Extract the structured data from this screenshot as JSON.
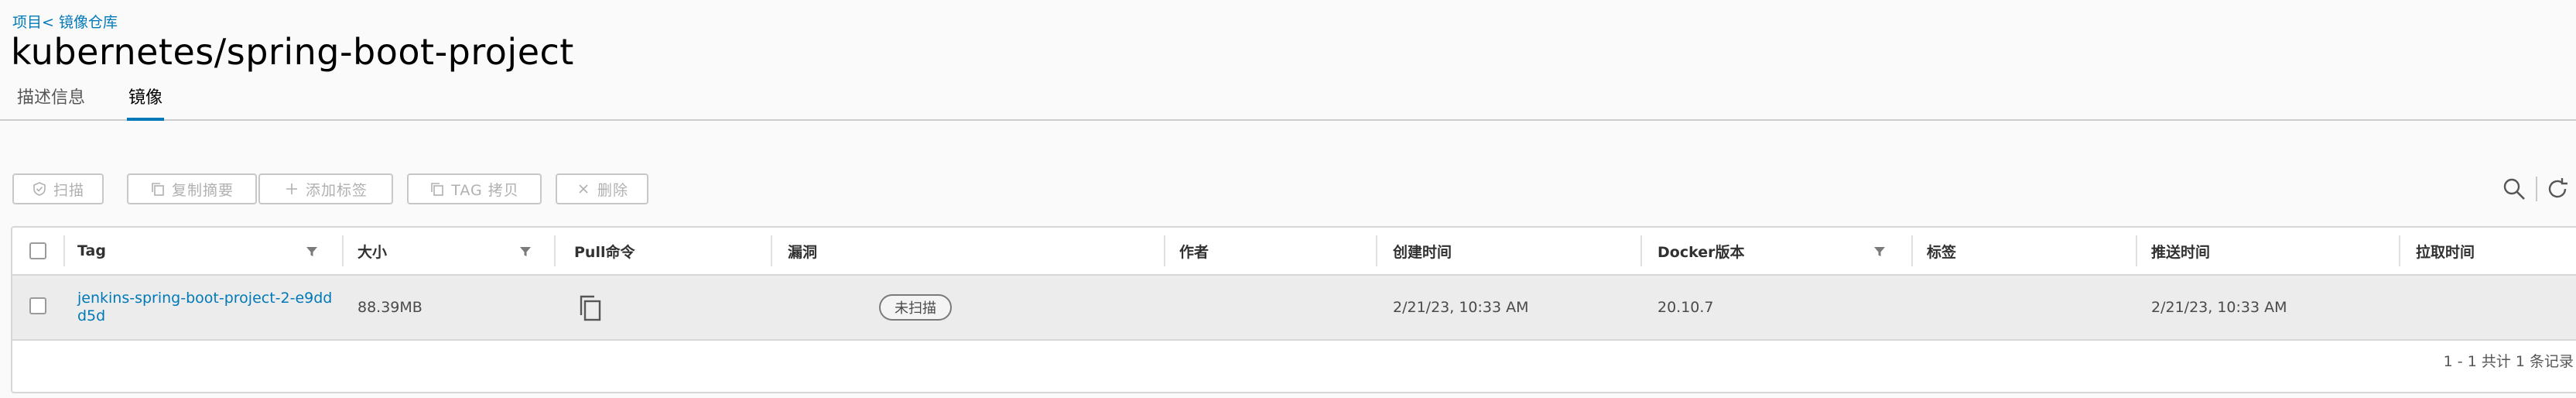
{
  "breadcrumb": "项目< 镜像仓库",
  "title": "kubernetes/spring-boot-project",
  "tabs": [
    {
      "label": "描述信息",
      "active": false
    },
    {
      "label": "镜像",
      "active": true
    }
  ],
  "toolbar": {
    "scan": "扫描",
    "copy_digest": "复制摘要",
    "add_label": "添加标签",
    "tag_copy": "TAG 拷贝",
    "delete": "删除"
  },
  "columns": {
    "tag": "Tag",
    "size": "大小",
    "pull": "Pull命令",
    "vuln": "漏洞",
    "author": "作者",
    "created": "创建时间",
    "docker": "Docker版本",
    "labels": "标签",
    "pushed": "推送时间",
    "pulled": "拉取时间"
  },
  "rows": [
    {
      "tag": "jenkins-spring-boot-project-2-e9ddd5d",
      "size": "88.39MB",
      "vuln": "未扫描",
      "author": "",
      "created": "2/21/23, 10:33 AM",
      "docker": "20.10.7",
      "labels": "",
      "pushed": "2/21/23, 10:33 AM",
      "pulled": ""
    }
  ],
  "footer": "1 - 1 共计 1 条记录",
  "colors": {
    "accent": "#0079b8",
    "disabled": "#b0b0b0",
    "row_bg": "#ececec"
  },
  "icons": {
    "scan": "shield-check-icon",
    "copy_digest": "copy-icon",
    "add_label": "plus-icon",
    "tag_copy": "copy-icon",
    "delete": "close-icon",
    "search": "search-icon",
    "refresh": "refresh-icon",
    "filter": "filter-icon",
    "pull_command": "copy-icon"
  }
}
